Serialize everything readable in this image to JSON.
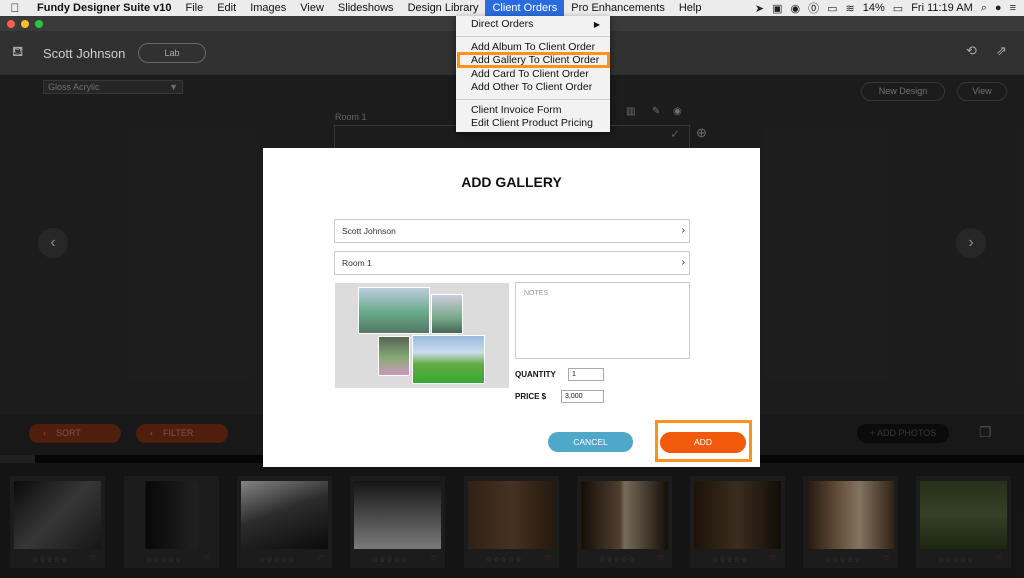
{
  "menubar": {
    "app_name": "Fundy Designer Suite v10",
    "items": [
      "File",
      "Edit",
      "Images",
      "View",
      "Slideshows",
      "Design Library",
      "Client Orders",
      "Pro Enhancements",
      "Help"
    ],
    "active_item": "Client Orders",
    "battery": "14%",
    "clock": "Fri 11:19 AM"
  },
  "toolbar": {
    "client_name": "Scott Johnson",
    "lab_label": "Lab",
    "material": "Gloss Acrylic",
    "new_design": "New Design",
    "view": "View",
    "room_label": "Room 1"
  },
  "bottombar": {
    "sort": "SORT",
    "filter": "FILTER",
    "add_photos": "+ ADD PHOTOS"
  },
  "dropdown": {
    "items": [
      "Direct Orders",
      "Add Album To Client Order",
      "Add Gallery To Client Order",
      "Add Card To Client Order",
      "Add Other To Client Order",
      "Client Invoice Form",
      "Edit Client Product Pricing"
    ],
    "highlighted": "Add Gallery To Client Order"
  },
  "modal": {
    "title": "ADD GALLERY",
    "client_field": "Scott Johnson",
    "room_field": "Room 1",
    "notes_placeholder": "NOTES",
    "quantity_label": "QUANTITY",
    "quantity_value": "1",
    "price_label": "PRICE $",
    "price_value": "3,000",
    "cancel_label": "CANCEL",
    "add_label": "ADD"
  },
  "colors": {
    "accent_orange": "#f15a0a",
    "highlight_orange": "#f7931e",
    "cancel_blue": "#4fa8c8",
    "menu_blue": "#2a6ce0"
  },
  "thumbnails": [
    {
      "stars": "☆☆☆☆☆",
      "heart": "♡"
    },
    {
      "stars": "☆☆☆☆☆",
      "heart": "♡"
    },
    {
      "stars": "☆☆☆☆☆",
      "heart": "♡"
    },
    {
      "stars": "☆☆☆☆☆",
      "heart": "♡"
    },
    {
      "stars": "☆☆☆☆☆",
      "heart": "♡"
    },
    {
      "stars": "☆☆☆☆☆",
      "heart": "♡"
    },
    {
      "stars": "☆☆☆☆☆",
      "heart": "♡"
    },
    {
      "stars": "☆☆☆☆☆",
      "heart": "♡"
    },
    {
      "stars": "☆☆☆☆☆",
      "heart": "♡"
    }
  ]
}
